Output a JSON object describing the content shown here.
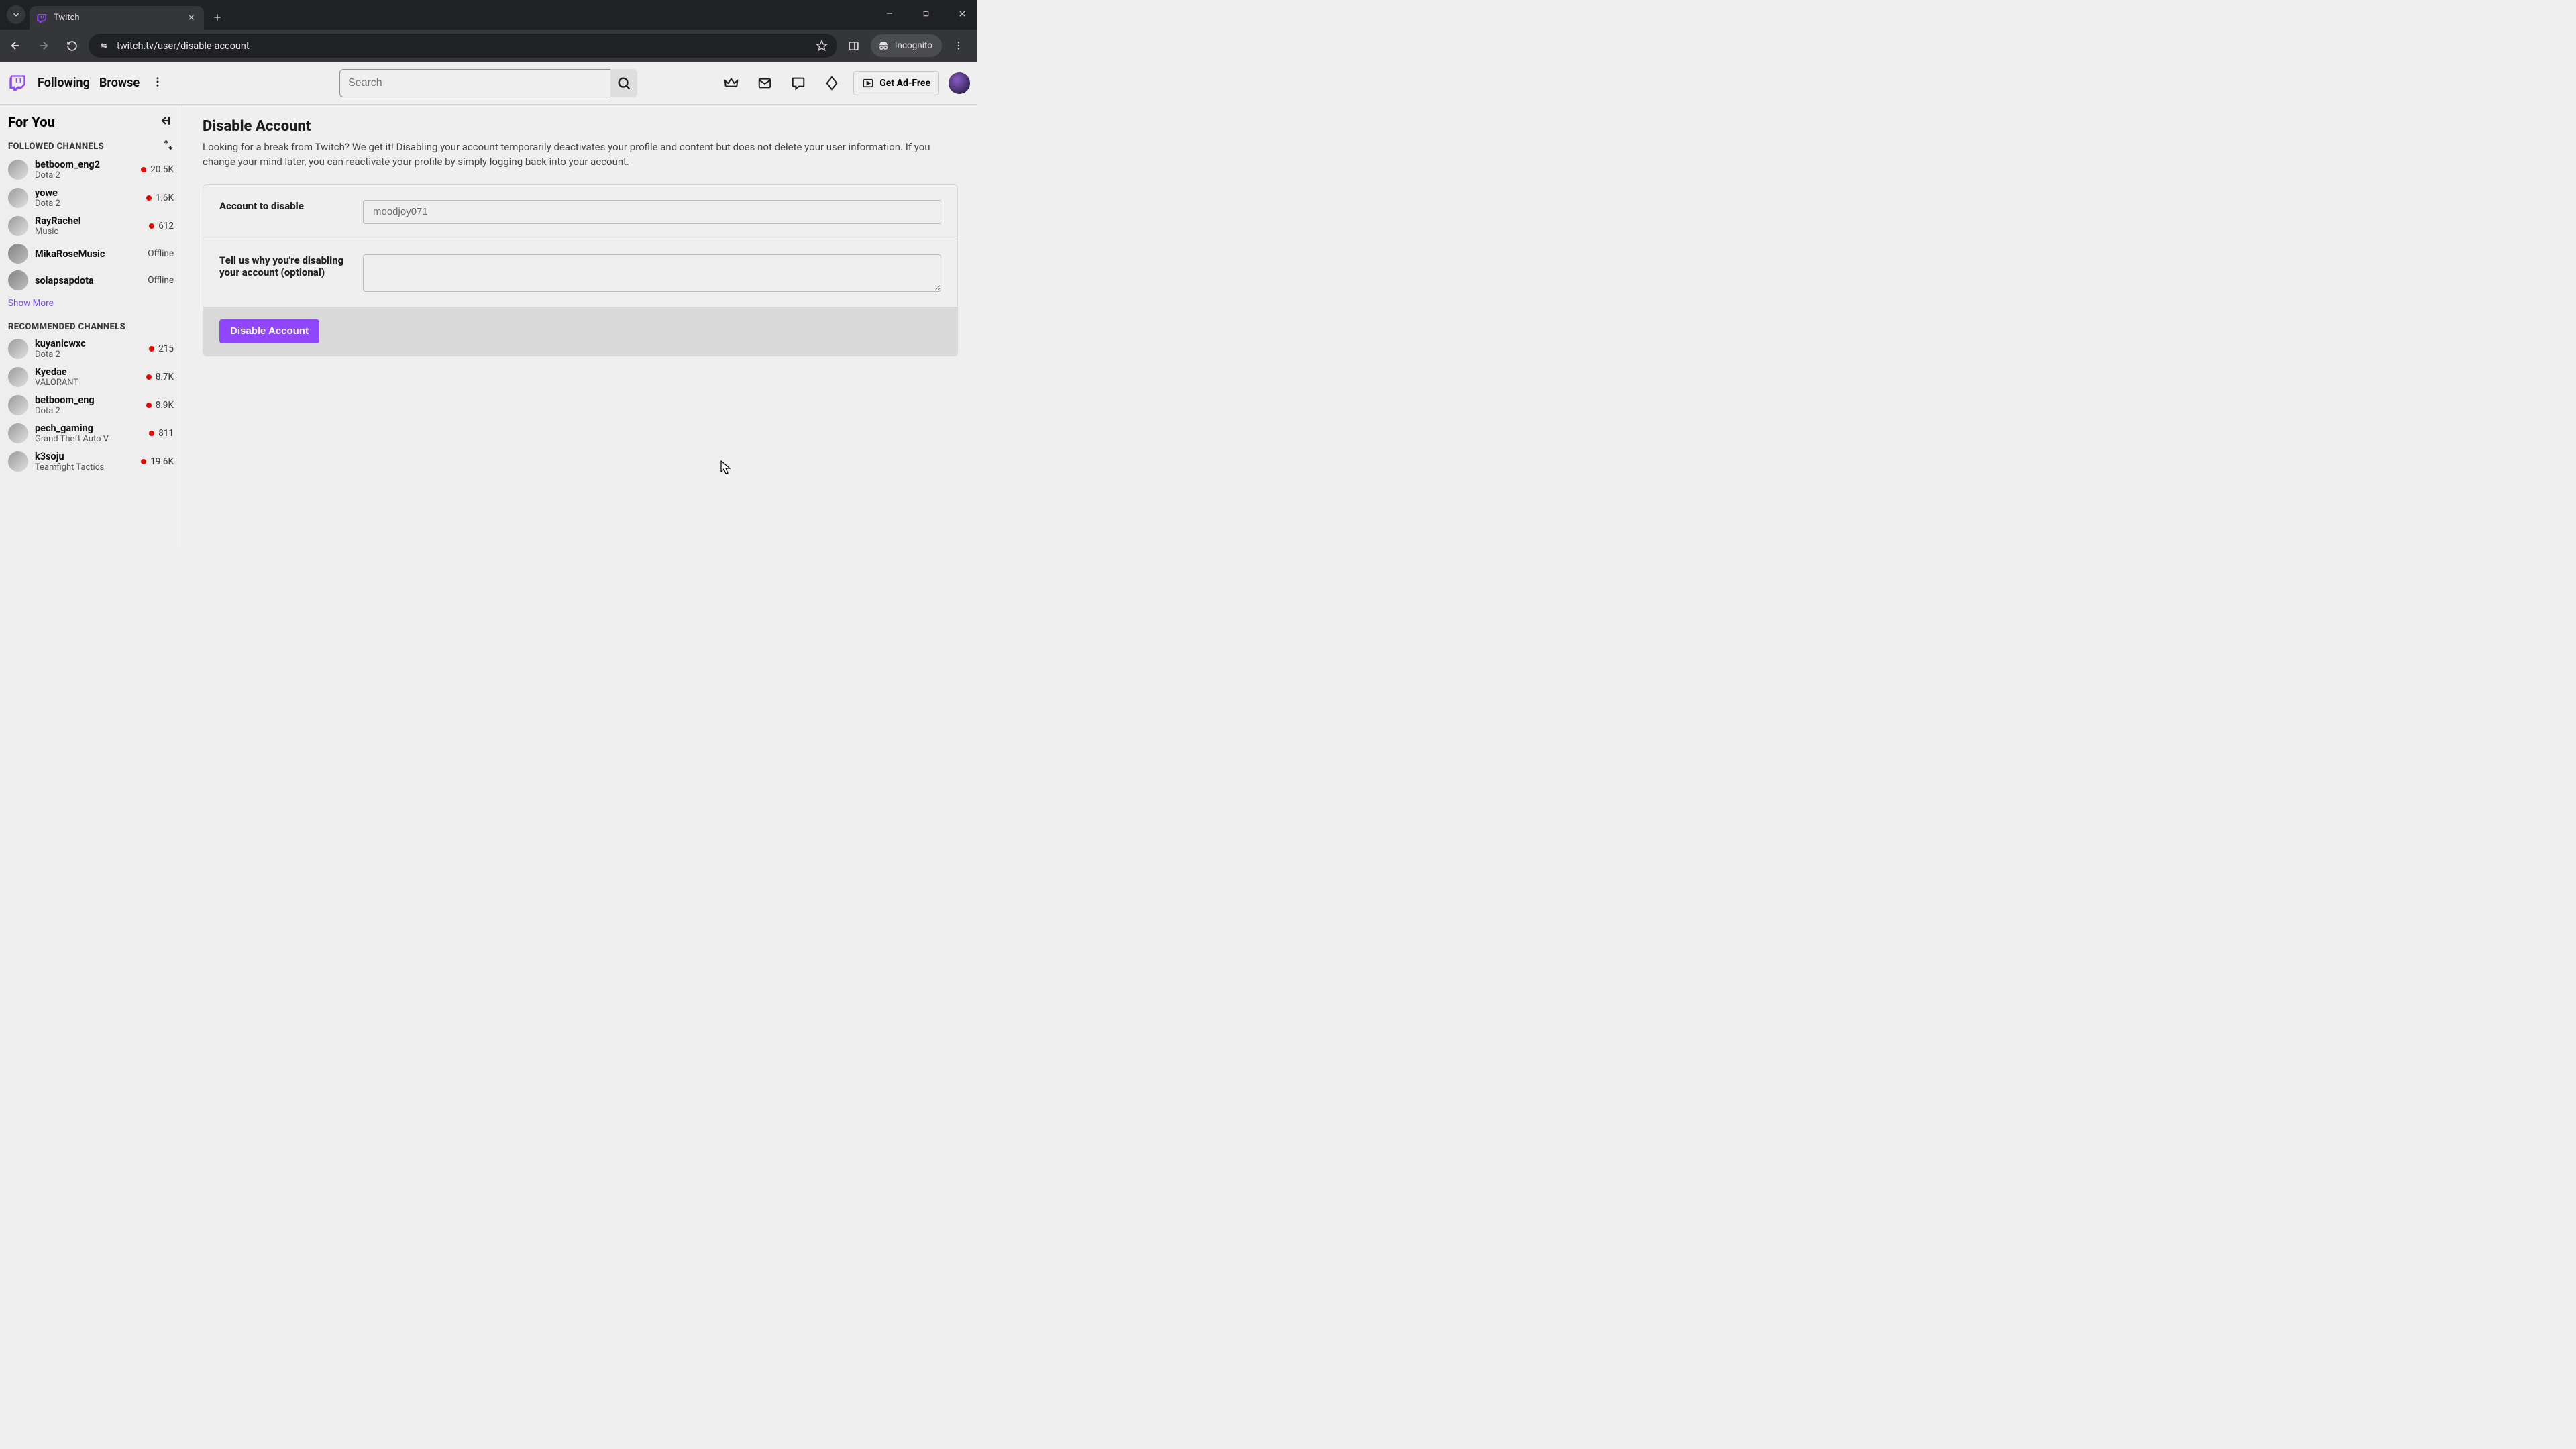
{
  "browser": {
    "tab_title": "Twitch",
    "url": "twitch.tv/user/disable-account",
    "incognito_label": "Incognito"
  },
  "header": {
    "nav_following": "Following",
    "nav_browse": "Browse",
    "search_placeholder": "Search",
    "ad_free_label": "Get Ad-Free"
  },
  "sidebar": {
    "for_you": "For You",
    "followed_heading": "FOLLOWED CHANNELS",
    "recommended_heading": "RECOMMENDED CHANNELS",
    "show_more": "Show More",
    "offline_label": "Offline",
    "followed": [
      {
        "name": "betboom_eng2",
        "game": "Dota 2",
        "viewers": "20.5K",
        "live": true
      },
      {
        "name": "yowe",
        "game": "Dota 2",
        "viewers": "1.6K",
        "live": true
      },
      {
        "name": "RayRachel",
        "game": "Music",
        "viewers": "612",
        "live": true
      },
      {
        "name": "MikaRoseMusic",
        "game": "",
        "viewers": "",
        "live": false
      },
      {
        "name": "solapsapdota",
        "game": "",
        "viewers": "",
        "live": false
      }
    ],
    "recommended": [
      {
        "name": "kuyanicwxc",
        "game": "Dota 2",
        "viewers": "215"
      },
      {
        "name": "Kyedae",
        "game": "VALORANT",
        "viewers": "8.7K"
      },
      {
        "name": "betboom_eng",
        "game": "Dota 2",
        "viewers": "8.9K"
      },
      {
        "name": "pech_gaming",
        "game": "Grand Theft Auto V",
        "viewers": "811"
      },
      {
        "name": "k3soju",
        "game": "Teamfight Tactics",
        "viewers": "19.6K"
      }
    ]
  },
  "main": {
    "heading": "Disable Account",
    "description": "Looking for a break from Twitch? We get it! Disabling your account temporarily deactivates your profile and content but does not delete your user information. If you change your mind later, you can reactivate your profile by simply logging back into your account.",
    "row1_label": "Account to disable",
    "account_value": "moodjoy071",
    "row2_label": "Tell us why you're disabling your account (optional)",
    "reason_value": "",
    "submit_label": "Disable Account"
  }
}
